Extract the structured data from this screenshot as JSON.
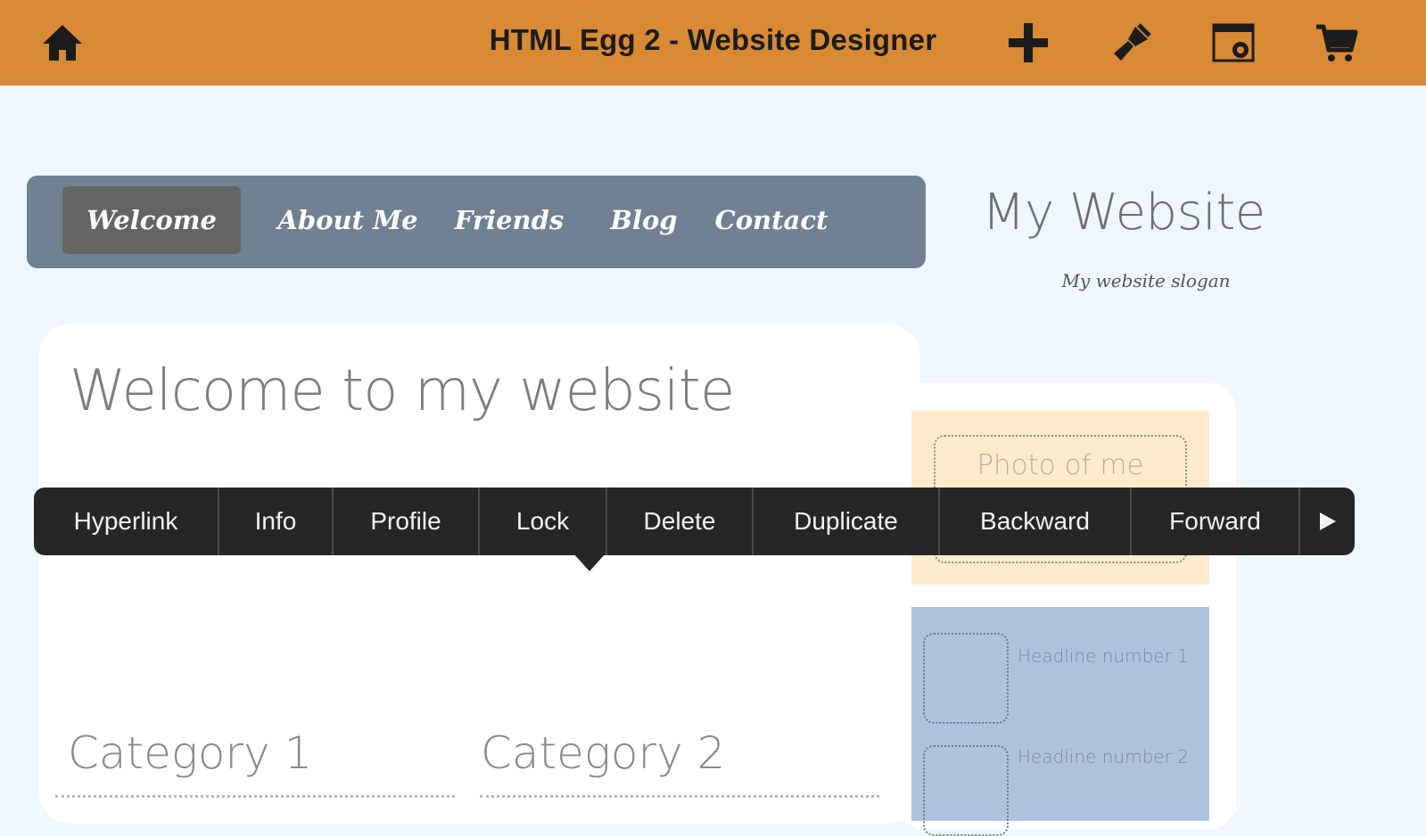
{
  "app": {
    "title": "HTML Egg 2 - Website Designer",
    "bar_color": "#d98a34"
  },
  "toolbar": {
    "icons": [
      "home-icon",
      "plus-icon",
      "paintbrush-icon",
      "preview-icon",
      "cart-icon"
    ]
  },
  "site": {
    "nav": [
      "Welcome",
      "About Me",
      "Friends",
      "Blog",
      "Contact"
    ],
    "active_nav": "Welcome",
    "title": "My Website",
    "slogan": "My website slogan",
    "heading": "Welcome to my website",
    "categories": [
      "Category 1",
      "Category 2"
    ],
    "sidebar": {
      "photo_label": "Photo of me",
      "headlines": [
        "Headline number 1",
        "Headline number 2"
      ]
    }
  },
  "context_menu": {
    "items": [
      "Hyperlink",
      "Info",
      "Profile",
      "Lock",
      "Delete",
      "Duplicate",
      "Backward",
      "Forward"
    ],
    "more_icon": "play-arrow-icon"
  }
}
